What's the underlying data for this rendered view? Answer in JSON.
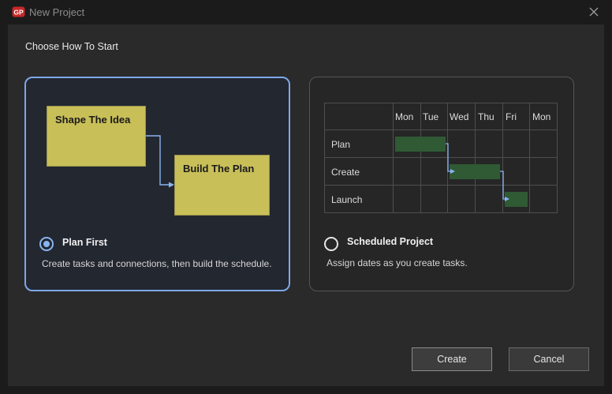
{
  "window": {
    "title": "New Project",
    "logo_text": "GP"
  },
  "section_title": "Choose How To Start",
  "options": {
    "plan_first": {
      "title": "Plan First",
      "description": "Create tasks and connections, then build the schedule.",
      "selected": true,
      "note1": "Shape The Idea",
      "note2": "Build The Plan"
    },
    "scheduled": {
      "title": "Scheduled Project",
      "description": "Assign dates as you create tasks.",
      "selected": false,
      "days": [
        "Mon",
        "Tue",
        "Wed",
        "Thu",
        "Fri",
        "Mon"
      ],
      "rows": [
        "Plan",
        "Create",
        "Launch"
      ]
    }
  },
  "buttons": {
    "create": "Create",
    "cancel": "Cancel"
  },
  "colors": {
    "accent": "#8ab4f0",
    "note": "#c9bf58",
    "gantt_bar": "#2f5a34"
  }
}
